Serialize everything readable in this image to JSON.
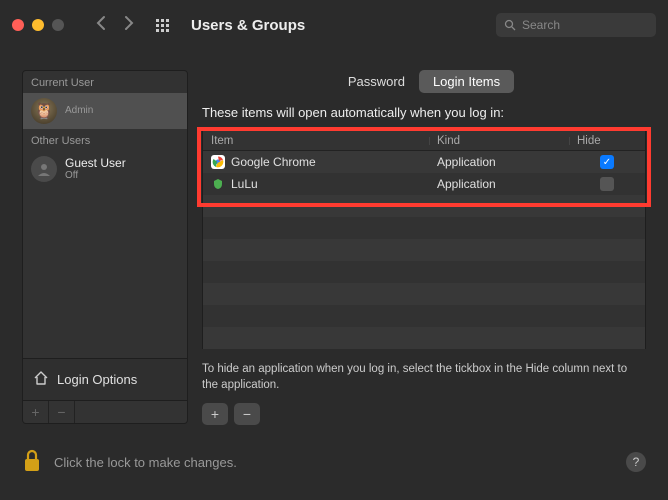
{
  "window": {
    "title": "Users & Groups"
  },
  "search": {
    "placeholder": "Search"
  },
  "sidebar": {
    "current_user_label": "Current User",
    "current_user": {
      "role": "Admin"
    },
    "other_users_label": "Other Users",
    "guest": {
      "name": "Guest User",
      "status": "Off"
    },
    "login_options_label": "Login Options"
  },
  "tabs": {
    "password": "Password",
    "login_items": "Login Items"
  },
  "main": {
    "intro": "These items will open automatically when you log in:",
    "columns": {
      "item": "Item",
      "kind": "Kind",
      "hide": "Hide"
    },
    "rows": [
      {
        "name": "Google Chrome",
        "kind": "Application",
        "hide": true
      },
      {
        "name": "LuLu",
        "kind": "Application",
        "hide": false
      }
    ],
    "hint": "To hide an application when you log in, select the tickbox in the Hide column next to the application."
  },
  "footer": {
    "lock_text": "Click the lock to make changes."
  }
}
